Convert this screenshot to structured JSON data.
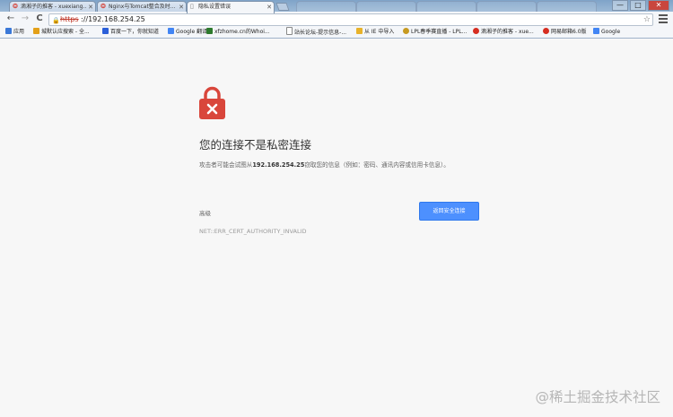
{
  "tabs": [
    {
      "label": "滴湘子的推客 - xuexiang...",
      "favicon": "weibo-icon"
    },
    {
      "label": "Nginx与Tomcat整合及时...",
      "favicon": "weibo-icon"
    },
    {
      "label": "隐私设置错误",
      "favicon": "page-icon"
    }
  ],
  "window_controls": {
    "minimize": "—",
    "maximize": "□",
    "close": "✕"
  },
  "omnibox": {
    "scheme": "https",
    "url": "://192.168.254.25",
    "star": "☆"
  },
  "nav": {
    "back": "←",
    "forward": "→",
    "reload": "C"
  },
  "bookmarks": [
    {
      "label": "应用",
      "color": "#3a78d8"
    },
    {
      "label": "城默认应搜索 - 全...",
      "color": "#e3a019"
    },
    {
      "label": "百度一下，你就知道",
      "color": "#2b5fd9"
    },
    {
      "label": "Google 翻译",
      "color": "#4285f4"
    },
    {
      "label": "xfzhome.cn的Whoi...",
      "color": "#2d7a2d"
    },
    {
      "label": "站长论坛-提示信息-...",
      "color": "#555555"
    },
    {
      "label": "从 IE 中导入",
      "color": "#e8b22a"
    },
    {
      "label": "LPL春季赛直播 - LPL...",
      "color": "#c79a21"
    },
    {
      "label": "滴湘子的推客 - xue...",
      "color": "#d62d20"
    },
    {
      "label": "网易邮箱6.0版",
      "color": "#d62d20"
    },
    {
      "label": "Google",
      "color": "#4285f4"
    }
  ],
  "error_page": {
    "title": "您的连接不是私密连接",
    "desc_prefix": "攻击者可能会试图从",
    "desc_host": "192.168.254.25",
    "desc_suffix": "窃取您的信息（例如：密码、通讯内容或信用卡信息）。",
    "advanced_link": "高级",
    "back_button": "返回安全连接",
    "error_code": "NET::ERR_CERT_AUTHORITY_INVALID",
    "icon_color": "#d9463b"
  },
  "watermark": "@稀土掘金技术社区"
}
